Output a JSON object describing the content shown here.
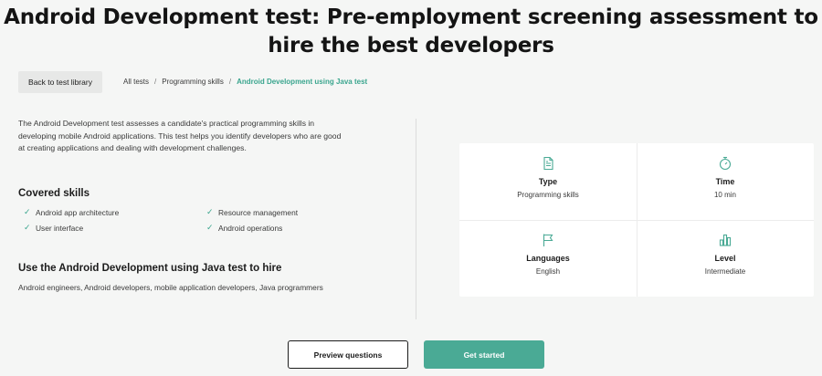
{
  "page": {
    "title_line1": "Android Development test: Pre-employment screening assessment to",
    "title_line2": "hire the best developers"
  },
  "nav": {
    "back_label": "Back to test library",
    "breadcrumb": [
      "All tests",
      "Programming skills",
      "Android Development using Java test"
    ],
    "separator": "/"
  },
  "main": {
    "description_lines": [
      "The Android Development test assesses a candidate's practical programming skills in",
      "developing mobile Android applications. This test helps you identify developers who are good",
      "at creating applications and dealing with development challenges."
    ],
    "covered_heading": "Covered skills",
    "skills": [
      "Android app architecture",
      "Resource management",
      "User interface",
      "Android operations"
    ],
    "hire_heading": "Use the Android Development using Java test to hire",
    "hire_text": "Android engineers, Android developers, mobile application developers, Java programmers"
  },
  "info_card": {
    "type": {
      "label": "Type",
      "value": "Programming skills",
      "icon": "document-icon"
    },
    "time": {
      "label": "Time",
      "value": "10 min",
      "icon": "stopwatch-icon"
    },
    "languages": {
      "label": "Languages",
      "value": "English",
      "icon": "flag-icon"
    },
    "level": {
      "label": "Level",
      "value": "Intermediate",
      "icon": "bar-chart-icon"
    }
  },
  "actions": {
    "preview_label": "Preview questions",
    "start_label": "Get started"
  },
  "colors": {
    "accent": "#4aaa95",
    "breadcrumb_active": "#3aa58e",
    "background": "#f5f6f5"
  }
}
